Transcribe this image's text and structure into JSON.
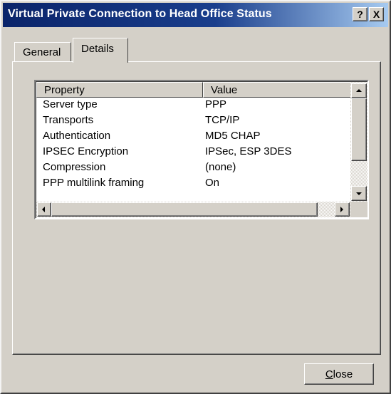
{
  "window": {
    "title": "Virtual Private Connection to Head Office Status",
    "help_button": "?",
    "close_button": "X"
  },
  "tabs": [
    {
      "label": "General",
      "selected": false
    },
    {
      "label": "Details",
      "selected": true
    }
  ],
  "listview": {
    "columns": [
      "Property",
      "Value"
    ],
    "rows": [
      {
        "property": "Server type",
        "value": "PPP"
      },
      {
        "property": "Transports",
        "value": "TCP/IP"
      },
      {
        "property": "Authentication",
        "value": "MD5 CHAP"
      },
      {
        "property": "IPSEC Encryption",
        "value": "IPSec, ESP 3DES"
      },
      {
        "property": "Compression",
        "value": "(none)"
      },
      {
        "property": "PPP multilink framing",
        "value": "On"
      }
    ]
  },
  "footer": {
    "close_label": "Close"
  },
  "colors": {
    "face": "#d4d0c8",
    "title_start": "#0a246a",
    "title_end": "#a6caf0"
  }
}
